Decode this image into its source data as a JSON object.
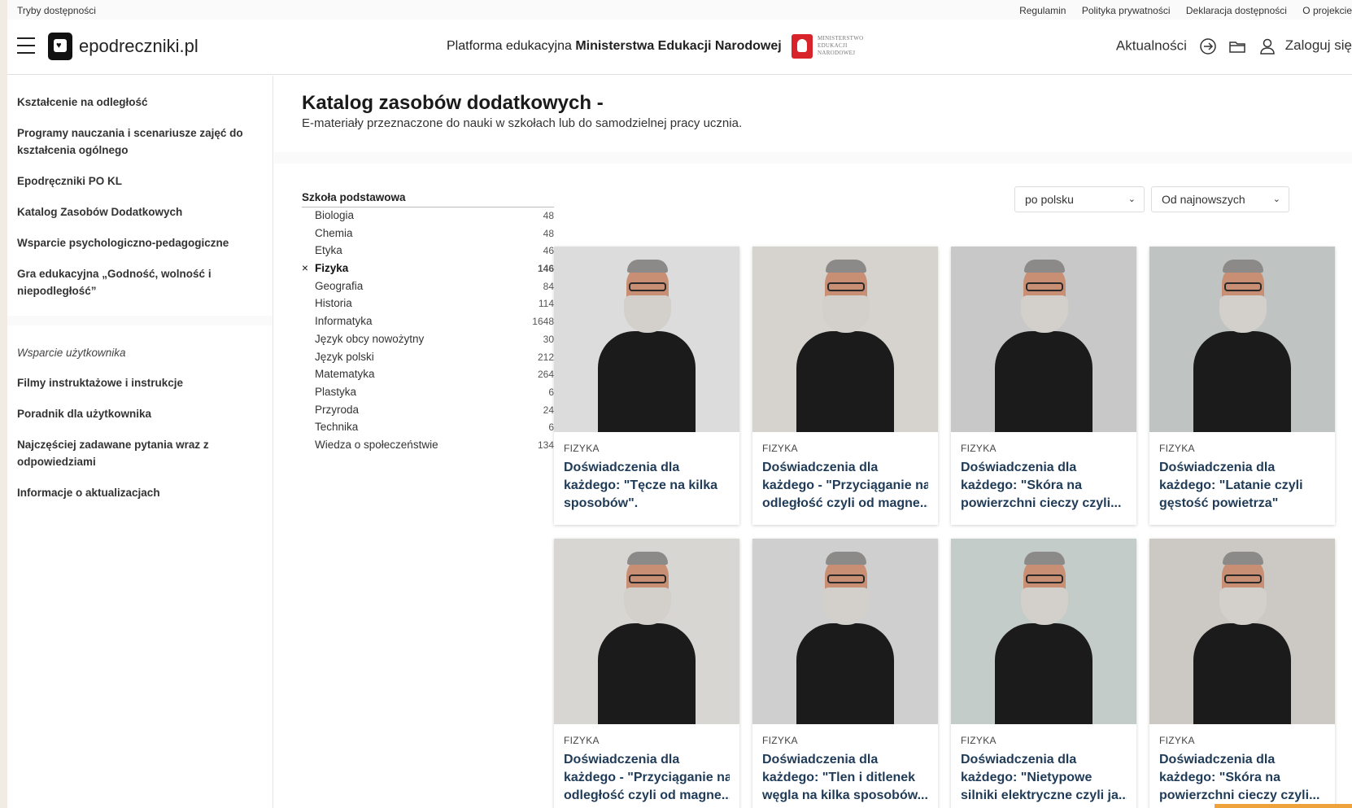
{
  "utilbar": {
    "left_label": "Tryby dostępności",
    "links": [
      "Regulamin",
      "Polityka prywatności",
      "Deklaracja dostępności",
      "O projekcie"
    ]
  },
  "header": {
    "logo_text": "epodreczniki.pl",
    "platform_prefix": "Platforma edukacyjna ",
    "platform_bold": "Ministerstwa Edukacji Narodowej",
    "ministry_lines": [
      "MINISTERSTWO",
      "EDUKACJI",
      "NARODOWEJ"
    ],
    "news_label": "Aktualności",
    "login_label": "Zaloguj się"
  },
  "sidebar": {
    "items": [
      "Kształcenie na odległość",
      "Programy nauczania i scenariusze zajęć do kształcenia ogólnego",
      "Epodręczniki PO KL",
      "Katalog Zasobów Dodatkowych",
      "Wsparcie psychologiczno-pedagogiczne",
      "Gra edukacyjna „Godność, wolność i niepodległość”"
    ],
    "support_title": "Wsparcie użytkownika",
    "support_items": [
      "Filmy instruktażowe i instrukcje",
      "Poradnik dla użytkownika",
      "Najczęściej zadawane pytania wraz z odpowiedziami",
      "Informacje o aktualizacjach"
    ]
  },
  "main": {
    "title": "Katalog zasobów dodatkowych -",
    "subtitle": "E-materiały przeznaczone do nauki w szkołach lub do samodzielnej pracy ucznia."
  },
  "filter": {
    "heading": "Szkoła podstawowa",
    "clear_symbol": "×",
    "subjects": [
      {
        "name": "Biologia",
        "count": "48"
      },
      {
        "name": "Chemia",
        "count": "48"
      },
      {
        "name": "Etyka",
        "count": "46"
      },
      {
        "name": "Fizyka",
        "count": "146"
      },
      {
        "name": "Geografia",
        "count": "84"
      },
      {
        "name": "Historia",
        "count": "114"
      },
      {
        "name": "Informatyka",
        "count": "1648"
      },
      {
        "name": "Język obcy nowożytny",
        "count": "30"
      },
      {
        "name": "Język polski",
        "count": "212"
      },
      {
        "name": "Matematyka",
        "count": "264"
      },
      {
        "name": "Plastyka",
        "count": "6"
      },
      {
        "name": "Przyroda",
        "count": "24"
      },
      {
        "name": "Technika",
        "count": "6"
      },
      {
        "name": "Wiedza o społeczeństwie",
        "count": "134"
      }
    ]
  },
  "selects": {
    "language": "po polsku",
    "sort": "Od najnowszych"
  },
  "cards": [
    {
      "category": "FIZYKA",
      "lines": [
        "Doświadczenia dla",
        "każdego: \"Tęcze na kilka",
        "sposobów\"."
      ]
    },
    {
      "category": "FIZYKA",
      "lines": [
        "Doświadczenia dla",
        "każdego - \"Przyciąganie na",
        "odległość czyli od magne..."
      ]
    },
    {
      "category": "FIZYKA",
      "lines": [
        "Doświadczenia dla",
        "każdego: \"Skóra na",
        "powierzchni cieczy czyli..."
      ]
    },
    {
      "category": "FIZYKA",
      "lines": [
        "Doświadczenia dla",
        "każdego: \"Latanie czyli",
        "gęstość powietrza\""
      ]
    },
    {
      "category": "FIZYKA",
      "lines": [
        "Doświadczenia dla",
        "każdego - \"Przyciąganie na",
        "odległość czyli od magne..."
      ]
    },
    {
      "category": "FIZYKA",
      "lines": [
        "Doświadczenia dla",
        "każdego: \"Tlen i ditlenek",
        "węgla na kilka sposobów..."
      ]
    },
    {
      "category": "FIZYKA",
      "lines": [
        "Doświadczenia dla",
        "każdego: \"Nietypowe",
        "silniki elektryczne czyli ja..."
      ]
    },
    {
      "category": "FIZYKA",
      "lines": [
        "Doświadczenia dla",
        "każdego: \"Skóra na",
        "powierzchni cieczy czyli..."
      ]
    }
  ],
  "colors": {
    "title_link": "#1f3b57",
    "accent_orange": "#f0a23a",
    "emblem_red": "#d8232a"
  }
}
